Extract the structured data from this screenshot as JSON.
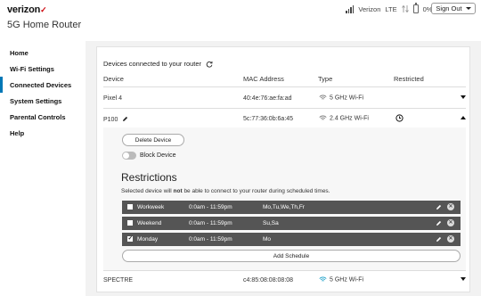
{
  "brand": {
    "name": "verizon",
    "check": "✓",
    "accent": "#cd040b"
  },
  "app_title": "5G Home Router",
  "status": {
    "carrier": "Verizon",
    "network": "LTE",
    "battery": "0%",
    "signout": "Sign Out"
  },
  "nav": [
    {
      "label": "Home"
    },
    {
      "label": "Wi-Fi Settings"
    },
    {
      "label": "Connected Devices",
      "active": true
    },
    {
      "label": "System Settings"
    },
    {
      "label": "Parental Controls"
    },
    {
      "label": "Help"
    }
  ],
  "devices": {
    "title": "Devices connected to your router",
    "columns": {
      "device": "Device",
      "mac": "MAC Address",
      "type": "Type",
      "restricted": "Restricted"
    },
    "rows": [
      {
        "name": "Pixel 4",
        "mac": "40:4e:76:ae:fa:ad",
        "type": "5 GHz Wi-Fi"
      },
      {
        "name": "P100",
        "mac": "5c:77:36:0b:6a:45",
        "type": "2.4 GHz Wi-Fi"
      },
      {
        "name": "SPECTRE",
        "mac": "c4:85:08:08:08:08",
        "type": "5 GHz Wi-Fi"
      }
    ]
  },
  "expanded": {
    "delete_label": "Delete Device",
    "block_label": "Block Device",
    "restrictions_title": "Restrictions",
    "desc_before": "Selected device will ",
    "desc_bold": "not",
    "desc_after": " be able to connect to your router during scheduled times.",
    "schedules": [
      {
        "name": "Workweek",
        "time": "0:0am - 11:59pm",
        "days": "Mo,Tu,We,Th,Fr",
        "checked": false
      },
      {
        "name": "Weekend",
        "time": "0:0am - 11:59pm",
        "days": "Su,Sa",
        "checked": false
      },
      {
        "name": "Monday",
        "time": "0:0am - 11:59pm",
        "days": "Mo",
        "checked": true
      }
    ],
    "add_label": "Add Schedule"
  }
}
